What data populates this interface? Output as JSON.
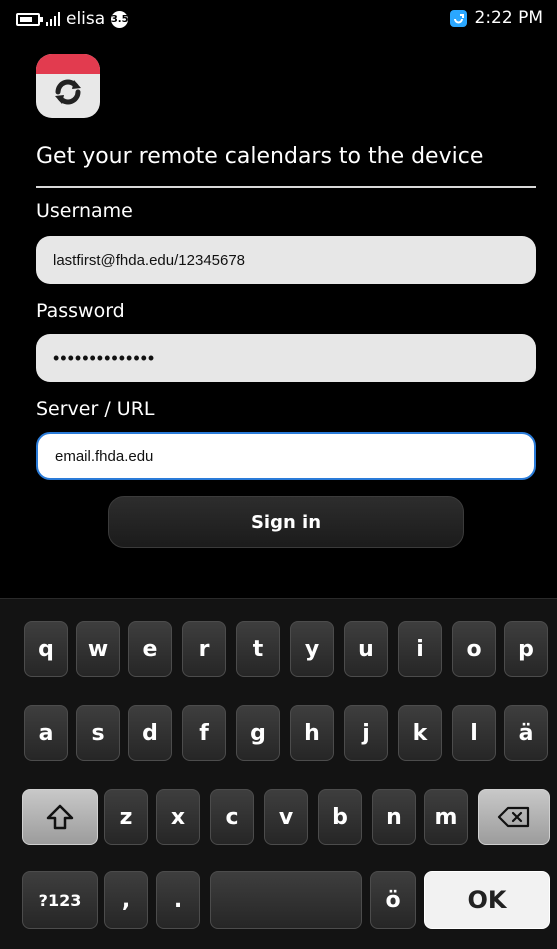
{
  "status_bar": {
    "carrier": "elisa",
    "network_badge": "3.5",
    "time": "2:22 PM",
    "icons": [
      "battery-icon",
      "signal-icon",
      "network-badge-icon",
      "sync-icon"
    ]
  },
  "app": {
    "icon": "calendar-sync-icon",
    "title": "Get your remote calendars to the device"
  },
  "form": {
    "username_label": "Username",
    "username_value": "lastfirst@fhda.edu/12345678",
    "password_label": "Password",
    "password_value": "••••••••••••••",
    "server_label": "Server / URL",
    "server_value": "email.fhda.edu",
    "signin_label": "Sign in"
  },
  "keyboard": {
    "row1": [
      "q",
      "w",
      "e",
      "r",
      "t",
      "y",
      "u",
      "i",
      "o",
      "p"
    ],
    "row2": [
      "a",
      "s",
      "d",
      "f",
      "g",
      "h",
      "j",
      "k",
      "l",
      "ä"
    ],
    "row3": [
      "z",
      "x",
      "c",
      "v",
      "b",
      "n",
      "m"
    ],
    "row4": {
      "sym": "?123",
      "comma": ",",
      "period": ".",
      "o_umlaut": "ö",
      "ok": "OK"
    },
    "shift_icon": "shift-icon",
    "backspace_icon": "backspace-icon"
  },
  "colors": {
    "background": "#000000",
    "focus_border": "#2a7bd8",
    "sync_blue": "#2aa7ff",
    "calendar_red": "#e23b4f"
  }
}
